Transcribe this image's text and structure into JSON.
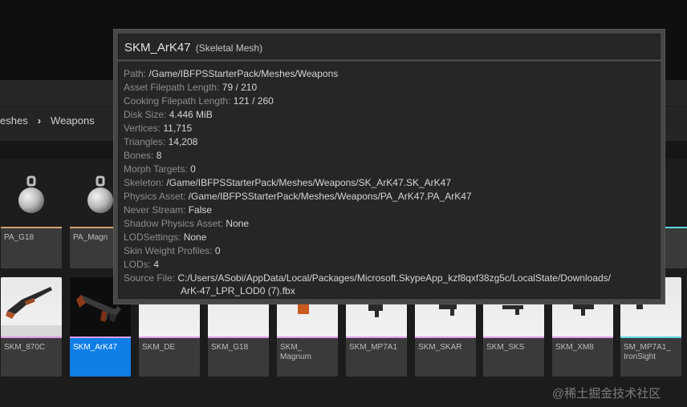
{
  "breadcrumb": {
    "items": [
      "eshes",
      "Weapons"
    ],
    "separator": "›"
  },
  "tiles_row1": [
    {
      "label": "PA_G18",
      "icon": "physics-asset-icon",
      "strip": "#d4a373"
    },
    {
      "label": "PA_Magn",
      "icon": "physics-asset-icon",
      "strip": "#d4a373"
    }
  ],
  "tiles_row2": [
    {
      "label": "SKM_870C",
      "strip": "#e09be8"
    },
    {
      "label": "SKM_ArK47",
      "strip": "#e09be8",
      "selected": true
    },
    {
      "label": "SKM_DE",
      "strip": "#e09be8"
    },
    {
      "label": "SKM_G18",
      "strip": "#e09be8"
    },
    {
      "label": "SKM_\nMagnum",
      "strip": "#e09be8"
    },
    {
      "label": "SKM_MP7A1",
      "strip": "#e09be8"
    },
    {
      "label": "SKM_SKAR",
      "strip": "#e09be8"
    },
    {
      "label": "SKM_SKS",
      "strip": "#e09be8"
    },
    {
      "label": "SKM_XM8",
      "strip": "#e09be8"
    },
    {
      "label": "SM_MP7A1_\nIronSight",
      "strip": "#5fd3e0"
    }
  ],
  "tooltip": {
    "title": "SKM_ArK47",
    "type": "(Skeletal Mesh)",
    "rows": [
      {
        "key": "Path:",
        "value": "/Game/IBFPSStarterPack/Meshes/Weapons"
      },
      {
        "key": "Asset Filepath Length:",
        "value": "79 / 210"
      },
      {
        "key": "Cooking Filepath Length:",
        "value": "121 / 260"
      },
      {
        "key": "Disk Size:",
        "value": "4.446 MiB"
      },
      {
        "key": "Vertices:",
        "value": "11,715"
      },
      {
        "key": "Triangles:",
        "value": "14,208"
      },
      {
        "key": "Bones:",
        "value": "8"
      },
      {
        "key": "Morph Targets:",
        "value": "0"
      },
      {
        "key": "Skeleton:",
        "value": "/Game/IBFPSStarterPack/Meshes/Weapons/SK_ArK47.SK_ArK47"
      },
      {
        "key": "Physics Asset:",
        "value": "/Game/IBFPSStarterPack/Meshes/Weapons/PA_ArK47.PA_ArK47"
      },
      {
        "key": "Never Stream:",
        "value": "False"
      },
      {
        "key": "Shadow Physics Asset:",
        "value": "None"
      },
      {
        "key": "LODSettings:",
        "value": "None"
      },
      {
        "key": "Skin Weight Profiles:",
        "value": "0"
      },
      {
        "key": "LODs:",
        "value": "4"
      },
      {
        "key": "Source File:",
        "value": "C:/Users/ASobi/AppData/Local/Packages/Microsoft.SkypeApp_kzf8qxf38zg5c/LocalState/Downloads/"
      }
    ],
    "source_file_cont": "ArK-47_LPR_LOD0 (7).fbx"
  },
  "watermark": "@稀土掘金技术社区"
}
